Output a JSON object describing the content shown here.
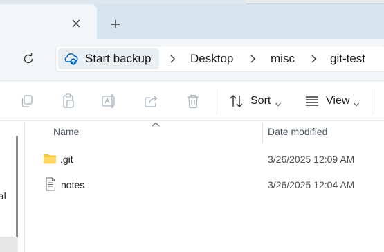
{
  "tabs": {
    "close_icon": "close-icon",
    "new_tab_icon": "plus-icon"
  },
  "address": {
    "refresh_icon": "refresh-icon",
    "breadcrumbs": [
      {
        "label": "Start backup",
        "icon": "cloud-backup-icon"
      },
      {
        "label": "Desktop"
      },
      {
        "label": "misc"
      },
      {
        "label": "git-test"
      }
    ]
  },
  "toolbar": {
    "sort_label": "Sort",
    "view_label": "View",
    "icons": [
      "copy-icon",
      "paste-icon",
      "rename-icon",
      "share-icon",
      "delete-icon",
      "sort-icon",
      "view-icon"
    ]
  },
  "nav": {
    "partial_item_label": "nal"
  },
  "file_list": {
    "columns": {
      "name": "Name",
      "date_modified": "Date modified"
    },
    "rows": [
      {
        "name": ".git",
        "date": "3/26/2025 12:09 AM",
        "icon": "folder-icon"
      },
      {
        "name": "notes",
        "date": "3/26/2025 12:04 AM",
        "icon": "text-file-icon"
      }
    ]
  },
  "colors": {
    "folder": "#f4c542",
    "accent": "#0067c0",
    "tabbar_bg": "#d6e4ee"
  }
}
